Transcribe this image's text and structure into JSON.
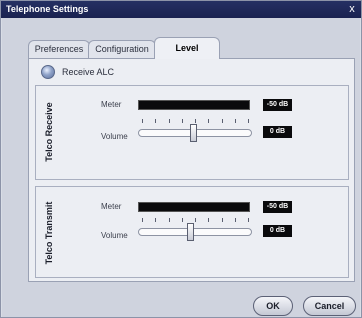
{
  "window": {
    "title": "Telephone Settings",
    "close_glyph": "x"
  },
  "tabs": [
    {
      "label": "Preferences",
      "active": false
    },
    {
      "label": "Configuration",
      "active": false
    },
    {
      "label": "Level",
      "active": true
    }
  ],
  "receive_alc": {
    "label": "Receive ALC",
    "selected": false
  },
  "telco_receive": {
    "title": "Telco Receive",
    "meter_label": "Meter",
    "meter_value": "-50 dB",
    "volume_label": "Volume",
    "volume_value": "0 dB",
    "volume_level_fraction": 0.48
  },
  "telco_transmit": {
    "title": "Telco Transmit",
    "meter_label": "Meter",
    "meter_value": "-50 dB",
    "volume_label": "Volume",
    "volume_value": "0 dB",
    "volume_level_fraction": 0.46
  },
  "buttons": {
    "ok": "OK",
    "cancel": "Cancel"
  },
  "colors": {
    "titlebar": "#1f2859",
    "panel": "#eceef3",
    "readout_bg": "#0a0a0c"
  }
}
